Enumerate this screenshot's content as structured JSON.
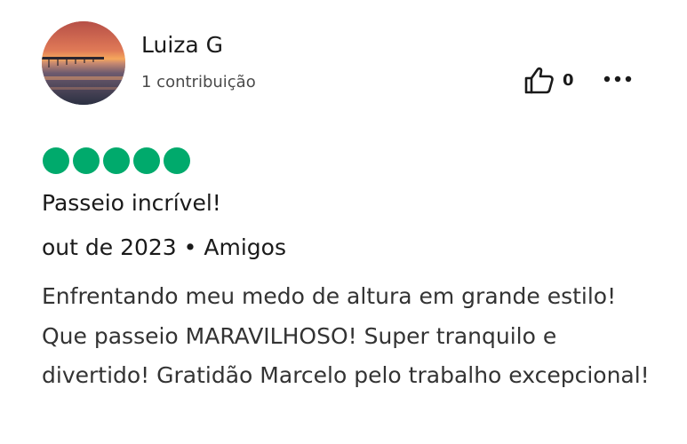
{
  "reviewer": {
    "name": "Luiza G",
    "contributions": "1 contribuição",
    "avatar_icon": "sunset-pier-photo"
  },
  "actions": {
    "helpful_icon": "thumbs-up-icon",
    "helpful_count": "0",
    "more_icon": "more-options-icon"
  },
  "review": {
    "rating": 5,
    "rating_max": 5,
    "rating_color": "#00aa6c",
    "title": "Passeio incrível!",
    "date": "out de 2023",
    "separator": "•",
    "trip_type": "Amigos",
    "text": "Enfrentando meu medo de altura em grande estilo! Que passeio MARAVILHOSO! Super tranquilo e divertido! Gratidão Marcelo pelo trabalho excepcional!"
  }
}
